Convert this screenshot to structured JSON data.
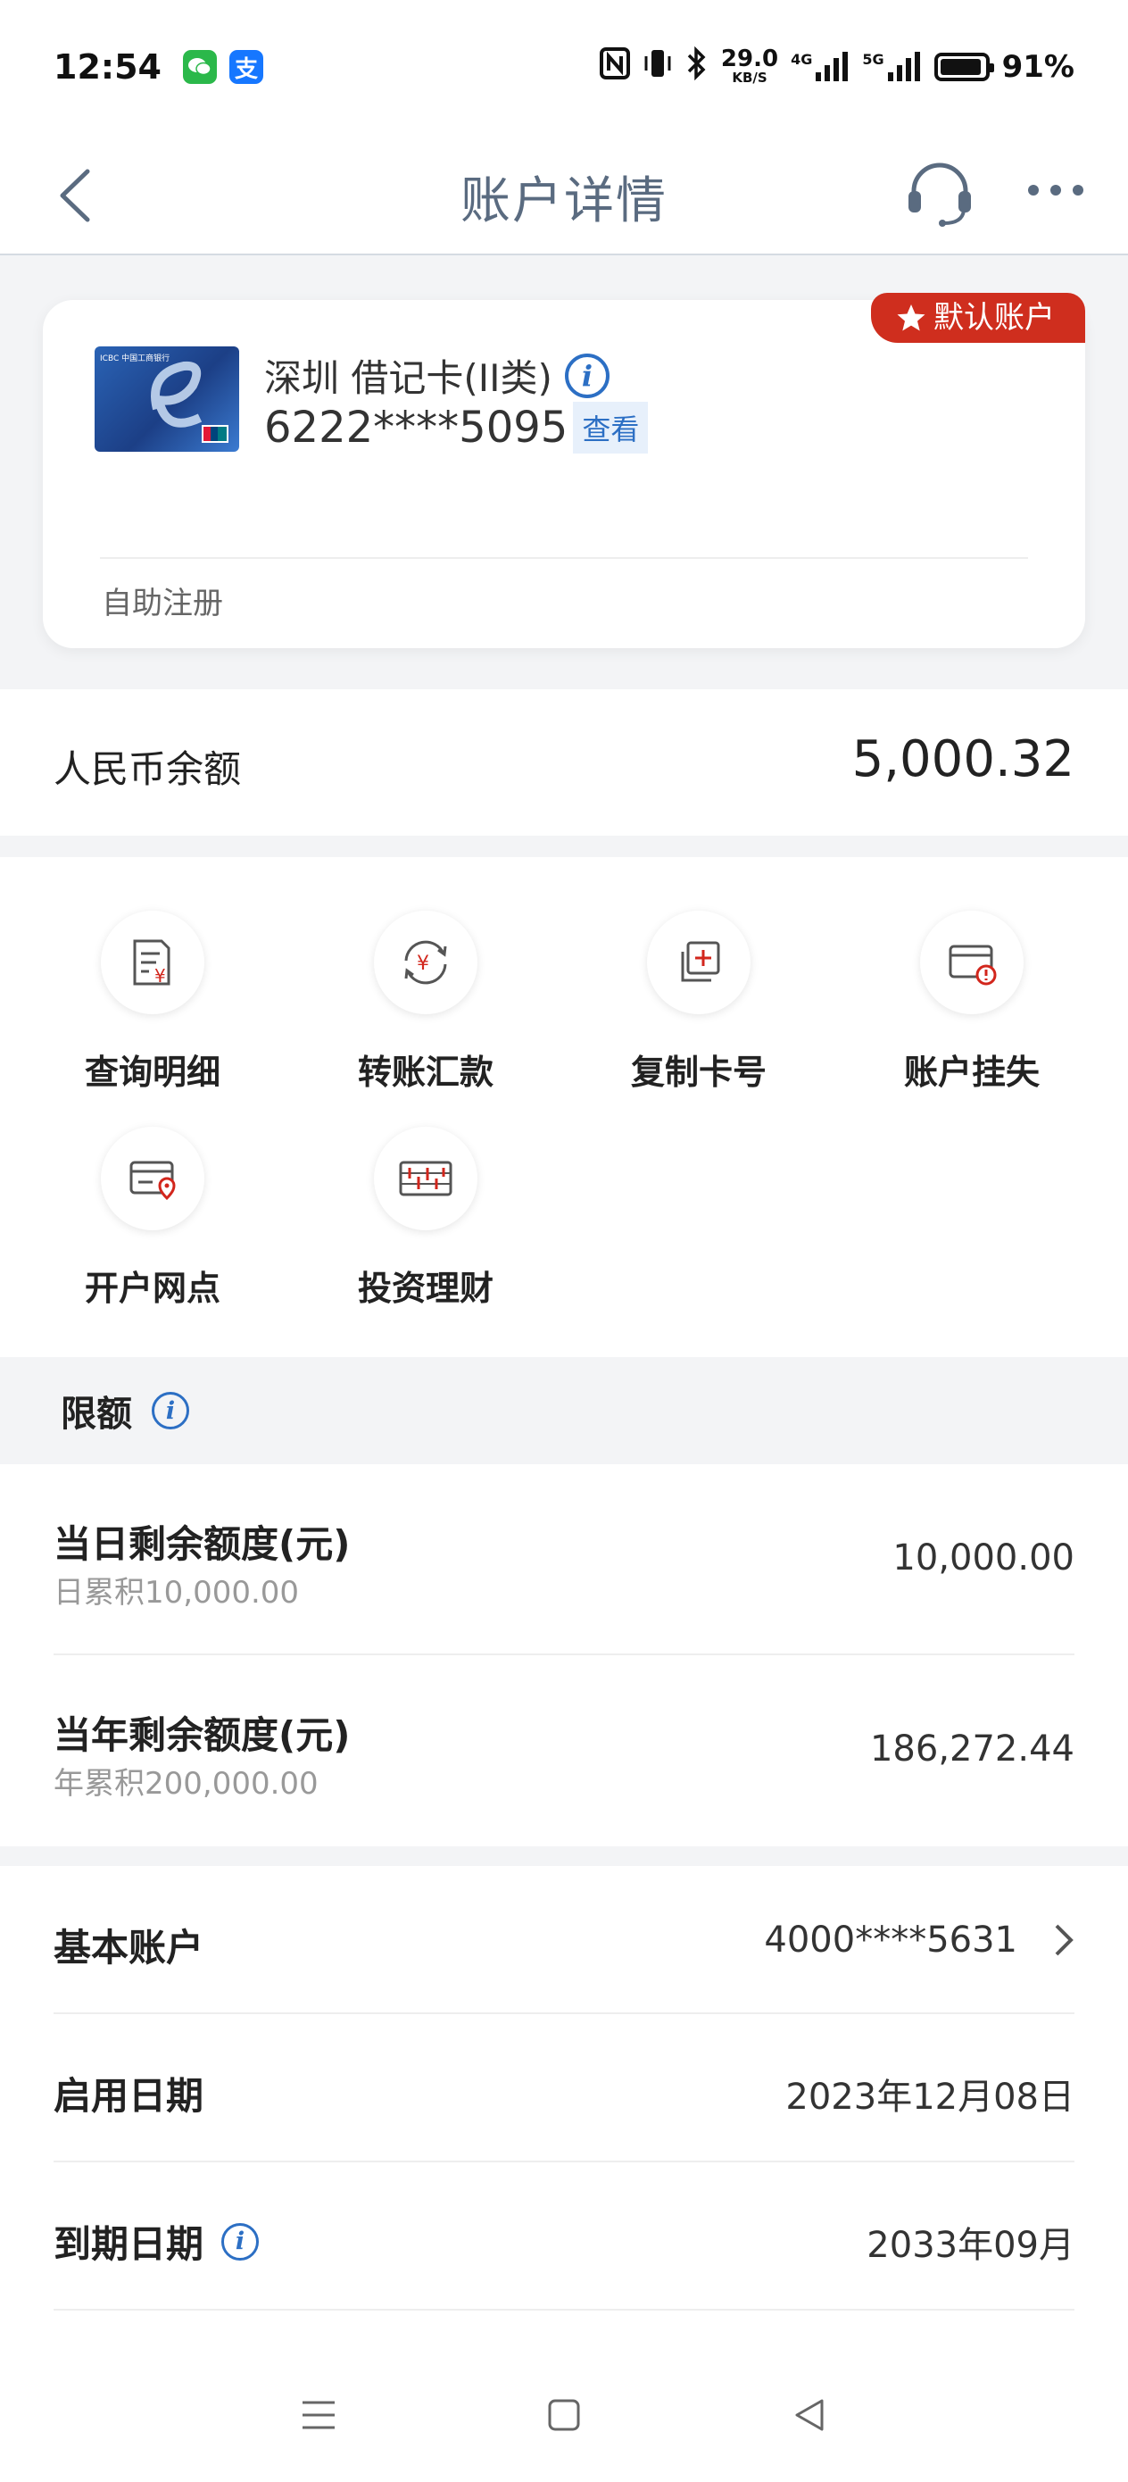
{
  "status_bar": {
    "time": "12:54",
    "net_speed_value": "29.0",
    "net_speed_unit": "KB/S",
    "net_4g": "4G",
    "net_5g": "5G",
    "battery": "91%",
    "app_icons": [
      "wechat-icon",
      "alipay-icon"
    ],
    "alipay_glyph": "支"
  },
  "nav": {
    "title": "账户详情"
  },
  "card": {
    "badge": "默认账户",
    "name": "深圳 借记卡(II类)",
    "number": "6222****5095",
    "view_label": "查看",
    "footer": "自助注册",
    "logo_text": "ICBC 中国工商银行"
  },
  "balance": {
    "label": "人民币余额",
    "value": "5,000.32"
  },
  "actions": [
    {
      "label": "查询明细",
      "icon": "statement-icon"
    },
    {
      "label": "转账汇款",
      "icon": "transfer-icon"
    },
    {
      "label": "复制卡号",
      "icon": "copy-icon"
    },
    {
      "label": "账户挂失",
      "icon": "report-loss-icon"
    },
    {
      "label": "开户网点",
      "icon": "branch-location-icon"
    },
    {
      "label": "投资理财",
      "icon": "investment-icon"
    }
  ],
  "limits": {
    "title": "限额",
    "rows": [
      {
        "label": "当日剩余额度(元)",
        "sub": "日累积10,000.00",
        "value": "10,000.00"
      },
      {
        "label": "当年剩余额度(元)",
        "sub": "年累积200,000.00",
        "value": "186,272.44"
      }
    ]
  },
  "info": [
    {
      "label": "基本账户",
      "value": "4000****5631"
    },
    {
      "label": "启用日期",
      "value": "2023年12月08日"
    },
    {
      "label": "到期日期",
      "value": "2033年09月"
    }
  ],
  "colors": {
    "accent_red": "#cf2e1e",
    "link_blue": "#2c6fc4",
    "nav_title": "#5a6b80"
  }
}
